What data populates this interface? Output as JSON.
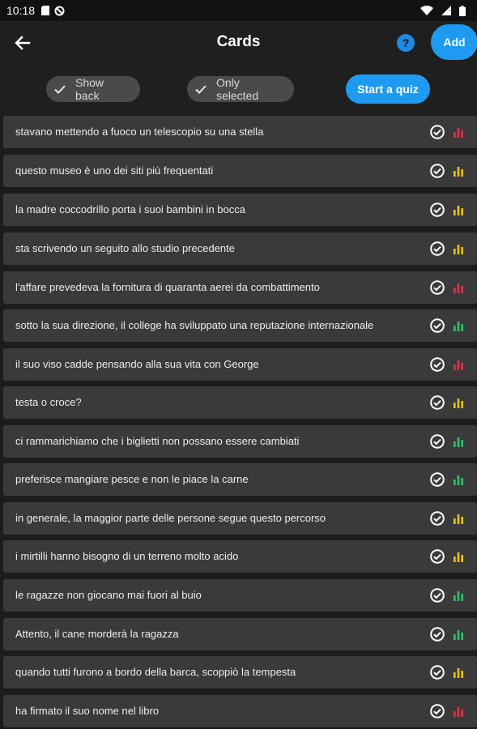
{
  "status": {
    "time": "10:18"
  },
  "header": {
    "title": "Cards",
    "help_label": "?",
    "add_label": "Add"
  },
  "filters": {
    "show_back": "Show back",
    "only_selected": "Only selected",
    "start_quiz": "Start a quiz"
  },
  "colors": {
    "red": "#e0324b",
    "yellow": "#e6c31e",
    "green": "#2ec26b",
    "accent": "#1e9bf0"
  },
  "cards": [
    {
      "text": "stavano mettendo a fuoco un telescopio su una stella",
      "status": "red"
    },
    {
      "text": "questo museo è uno dei siti più frequentati",
      "status": "yellow"
    },
    {
      "text": "la madre coccodrillo porta i suoi bambini in bocca",
      "status": "yellow"
    },
    {
      "text": "sta scrivendo un seguito allo studio precedente",
      "status": "yellow"
    },
    {
      "text": "l'affare prevedeva la fornitura di quaranta aerei da combattimento",
      "status": "red"
    },
    {
      "text": "sotto la sua direzione, il college ha sviluppato una reputazione internazionale",
      "status": "green"
    },
    {
      "text": "il suo viso cadde pensando alla sua vita con George",
      "status": "red"
    },
    {
      "text": "testa o croce?",
      "status": "yellow"
    },
    {
      "text": "ci rammarichiamo che i biglietti non possano essere cambiati",
      "status": "green"
    },
    {
      "text": "preferisce mangiare pesce e non le piace la carne",
      "status": "green"
    },
    {
      "text": "in generale, la maggior parte delle persone segue questo percorso",
      "status": "yellow"
    },
    {
      "text": "i mirtilli hanno bisogno di un terreno molto acido",
      "status": "yellow"
    },
    {
      "text": "le ragazze non giocano mai fuori al buio",
      "status": "green"
    },
    {
      "text": "Attento, il cane morderà la ragazza",
      "status": "green"
    },
    {
      "text": "quando tutti furono a bordo della barca, scoppiò la tempesta",
      "status": "yellow"
    },
    {
      "text": "ha firmato il suo nome nel libro",
      "status": "red"
    }
  ]
}
